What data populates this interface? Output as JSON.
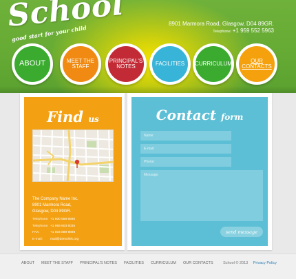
{
  "logo": {
    "title": "School",
    "tagline": "good start for your child"
  },
  "header": {
    "address": "8901 Marmora Road, Glasgow,  D04 89GR.",
    "phone_label": "Telephone:",
    "phone_number": "+1 959 552 5963"
  },
  "nav": [
    {
      "label": "About",
      "color": "#3aab2f"
    },
    {
      "label": "Meet the staff",
      "color": "#f08a12"
    },
    {
      "label": "Principal's notes",
      "color": "#c22b36"
    },
    {
      "label": "Facilities",
      "color": "#38b4d8"
    },
    {
      "label": "Curriculum",
      "color": "#3aab2f"
    },
    {
      "label": "Our contacts",
      "color": "#f5a10e"
    }
  ],
  "find": {
    "title": "Find",
    "title_small": "us",
    "company": "The Company Name Inc.",
    "street": "8901 Marmora Road,",
    "city": "Glasgow, D04 89GR.",
    "contacts": [
      {
        "label": "Telephone:",
        "value": "+1 800 559 6580"
      },
      {
        "label": "Telephone:",
        "value": "+1 959 603 6035"
      },
      {
        "label": "FAX:",
        "value": "+1 504 889 9898"
      },
      {
        "label": "E-mail:",
        "value": "mail@demolink.org"
      }
    ]
  },
  "contact": {
    "title": "Contact",
    "title_small": "form",
    "name_placeholder": "Name:",
    "email_placeholder": "E-mail:",
    "phone_placeholder": "Phone:",
    "message_placeholder": "Message:",
    "send_label": "send message"
  },
  "footer": {
    "links": [
      "About",
      "Meet the staff",
      "Principal's notes",
      "Facilities",
      "Curriculum",
      "Our contacts"
    ],
    "copyright": "School © 2013",
    "privacy": "Privacy Policy"
  },
  "colors": {
    "find_bg": "#f3a112",
    "contact_bg": "#5cbfd5",
    "header_green": "#66ab34",
    "header_yellow": "#f6e300"
  }
}
